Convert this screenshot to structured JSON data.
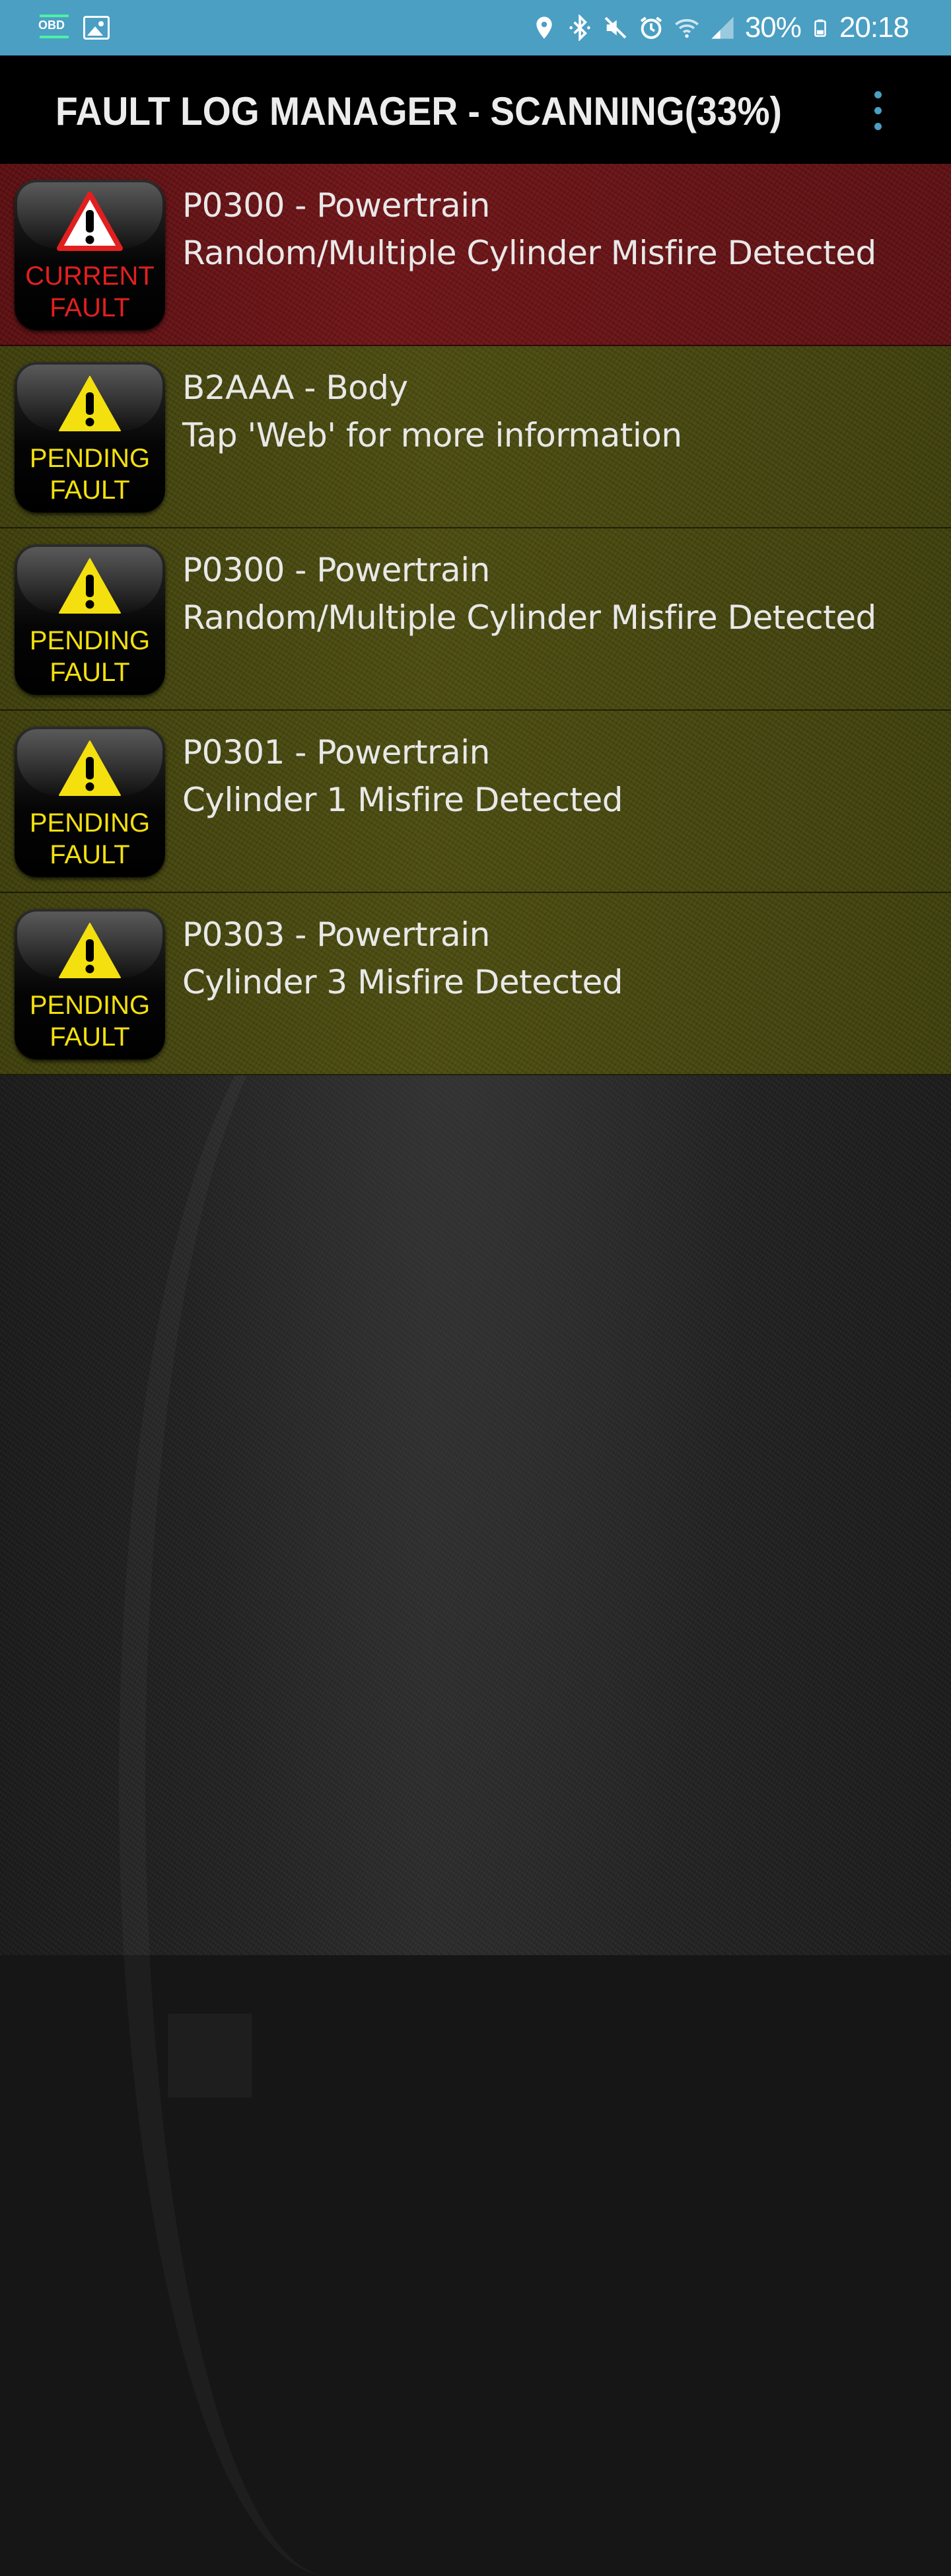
{
  "status_bar": {
    "left_icons": [
      "obd-notification-icon",
      "image-notification-icon"
    ],
    "obd_label": "OBD",
    "right_icons": [
      "location-icon",
      "bluetooth-icon",
      "mute-icon",
      "alarm-icon",
      "wifi-icon",
      "signal-icon",
      "battery-icon"
    ],
    "battery": "30%",
    "time": "20:18"
  },
  "toolbar": {
    "title": "FAULT LOG MANAGER - SCANNING(33%)",
    "menu_icon": "more-vertical-icon",
    "accent_color": "#4a9fc3"
  },
  "colors": {
    "current_row": "#6f1417",
    "pending_row": "#4c4d10",
    "current_badge_text": "#e21f1f",
    "pending_badge_text": "#f3e00e"
  },
  "faults": [
    {
      "status": "current",
      "badge_line1": "CURRENT",
      "badge_line2": "FAULT",
      "code": "P0300 - Powertrain",
      "description": "Random/Multiple Cylinder Misfire Detected"
    },
    {
      "status": "pending",
      "badge_line1": "PENDING",
      "badge_line2": "FAULT",
      "code": "B2AAA - Body",
      "description": "Tap 'Web' for more information"
    },
    {
      "status": "pending",
      "badge_line1": "PENDING",
      "badge_line2": "FAULT",
      "code": "P0300 - Powertrain",
      "description": "Random/Multiple Cylinder Misfire Detected"
    },
    {
      "status": "pending",
      "badge_line1": "PENDING",
      "badge_line2": "FAULT",
      "code": "P0301 - Powertrain",
      "description": "Cylinder 1 Misfire Detected"
    },
    {
      "status": "pending",
      "badge_line1": "PENDING",
      "badge_line2": "FAULT",
      "code": "P0303 - Powertrain",
      "description": "Cylinder 3 Misfire Detected"
    }
  ]
}
